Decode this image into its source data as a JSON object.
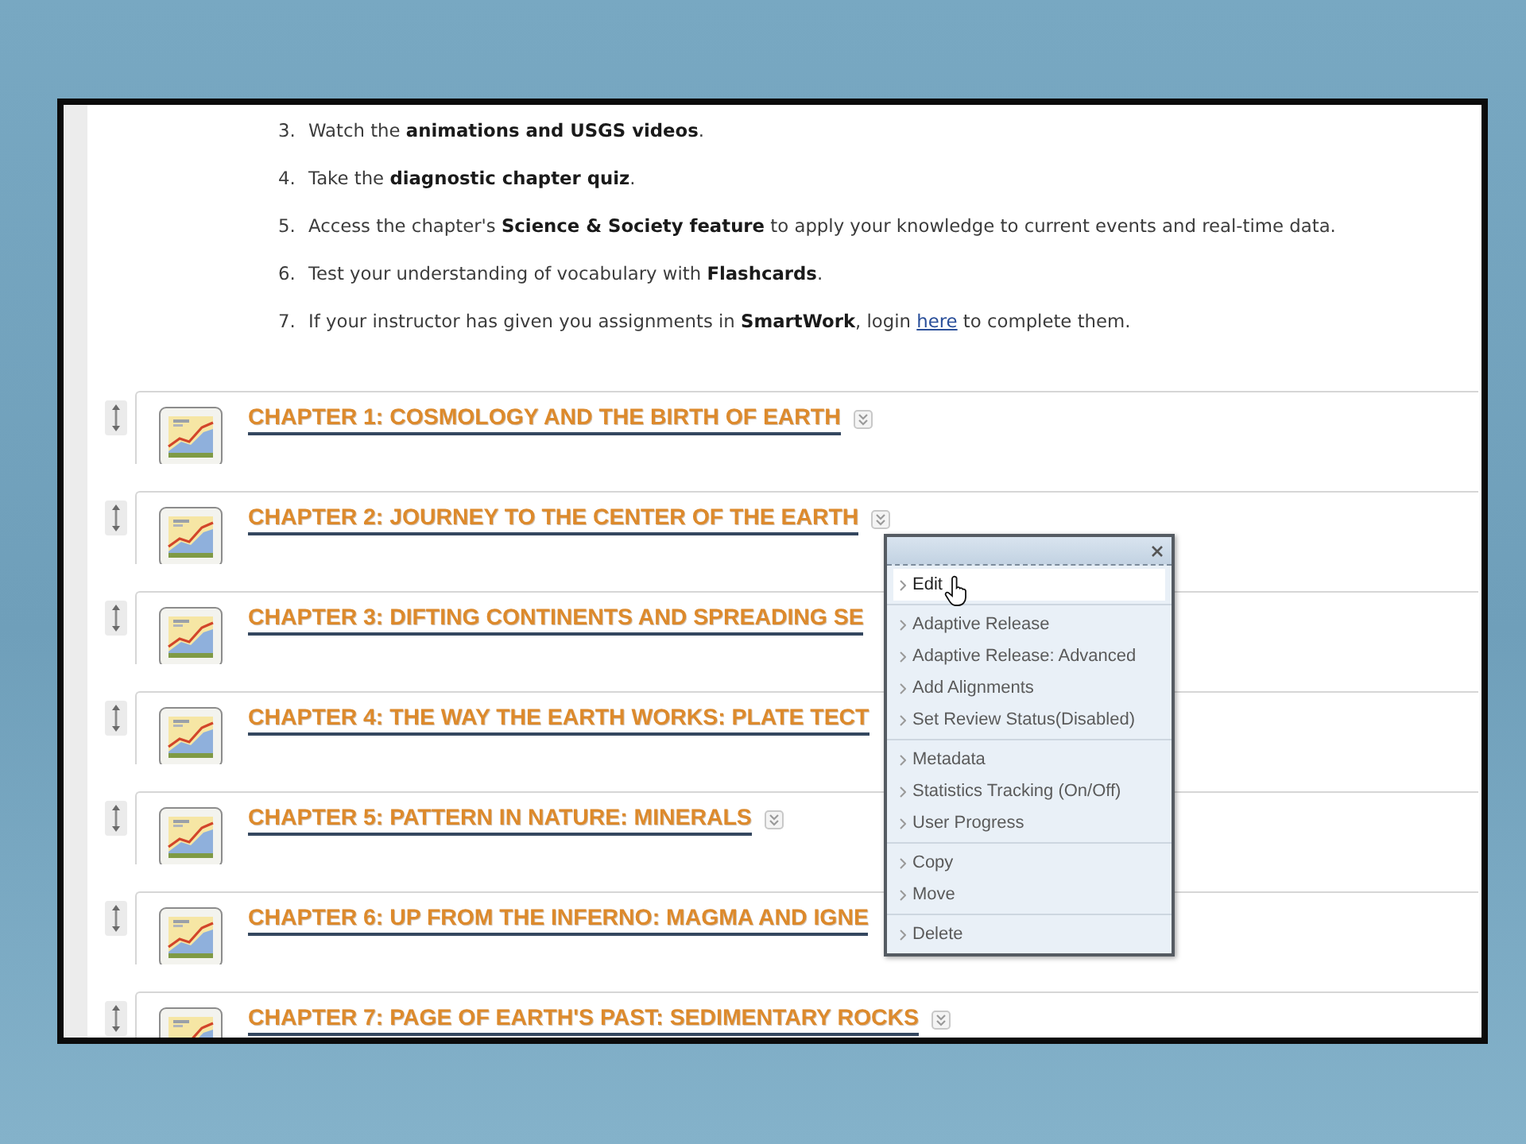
{
  "instructions": [
    {
      "number": "3.",
      "text": "Watch the **animations and USGS videos**."
    },
    {
      "number": "4.",
      "text": "Take the **diagnostic chapter quiz**."
    },
    {
      "number": "5.",
      "text": "Access the chapter's **Science & Society feature** to apply your knowledge to current events and real-time data."
    },
    {
      "number": "6.",
      "text": "Test your understanding of vocabulary with **Flashcards**."
    },
    {
      "number": "7.",
      "text": "If your instructor has given you assignments in **SmartWork**, login",
      "link": "here",
      "text_after": "to complete them."
    }
  ],
  "chapters": [
    {
      "title": "CHAPTER 1: COSMOLOGY AND THE BIRTH OF EARTH",
      "menu_button": true
    },
    {
      "title": "CHAPTER 2: JOURNEY TO THE CENTER OF THE EARTH",
      "menu_button": true
    },
    {
      "title": "CHAPTER 3: DIFTING CONTINENTS AND SPREADING SE",
      "menu_button": false
    },
    {
      "title": "CHAPTER 4: THE WAY THE EARTH WORKS: PLATE TECT",
      "menu_button": false
    },
    {
      "title": "CHAPTER 5: PATTERN IN NATURE: MINERALS",
      "menu_button": true
    },
    {
      "title": "CHAPTER 6: UP FROM THE INFERNO: MAGMA AND IGNE",
      "menu_button": false
    },
    {
      "title": "CHAPTER 7: PAGE OF EARTH'S PAST: SEDIMENTARY ROCKS",
      "menu_button": true
    }
  ],
  "context_menu": {
    "groups": [
      {
        "items": [
          {
            "label": "Edit",
            "selected": true
          }
        ]
      },
      {
        "items": [
          {
            "label": "Adaptive Release",
            "selected": false
          },
          {
            "label": "Adaptive Release: Advanced",
            "selected": false
          },
          {
            "label": "Add Alignments",
            "selected": false
          },
          {
            "label": "Set Review Status(Disabled)",
            "selected": false
          }
        ]
      },
      {
        "items": [
          {
            "label": "Metadata",
            "selected": false
          },
          {
            "label": "Statistics Tracking (On/Off)",
            "selected": false
          },
          {
            "label": "User Progress",
            "selected": false
          }
        ]
      },
      {
        "items": [
          {
            "label": "Copy",
            "selected": false
          },
          {
            "label": "Move",
            "selected": false
          }
        ]
      },
      {
        "items": [
          {
            "label": "Delete",
            "selected": false
          }
        ]
      }
    ]
  }
}
